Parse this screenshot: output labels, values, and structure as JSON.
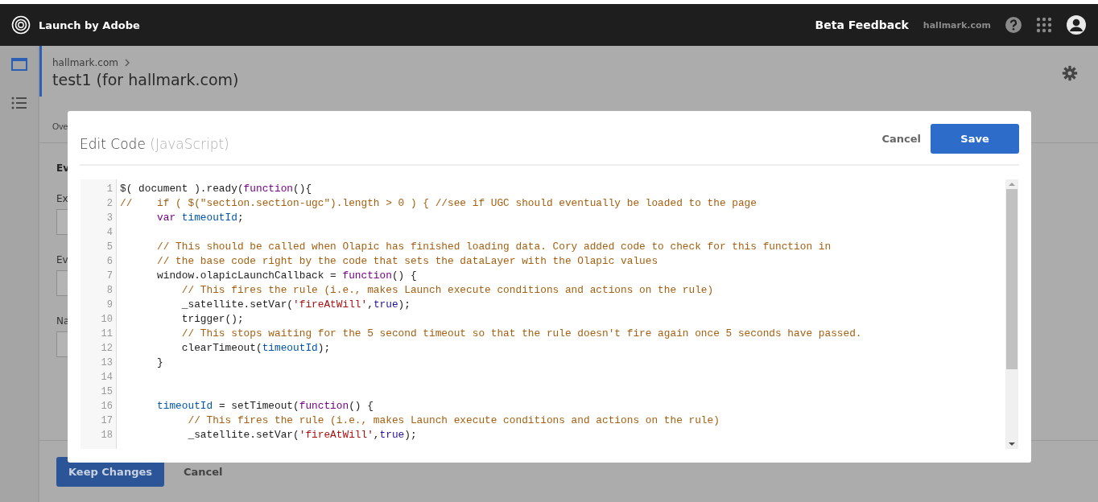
{
  "top_bar": {
    "product": "Launch by Adobe",
    "feedback": "Beta Feedback",
    "org": "hallmark.com"
  },
  "sidebar": {
    "items": [
      {
        "kind": "window",
        "selected": true
      },
      {
        "kind": "list",
        "selected": false
      }
    ]
  },
  "page": {
    "breadcrumb": "hallmark.com",
    "title": "test1 (for hallmark.com)",
    "tab": "Ove",
    "section": "Ev",
    "fields": [
      {
        "label": "Ex"
      },
      {
        "label": "Ev"
      },
      {
        "label": "Na"
      }
    ],
    "primary_button": "Keep Changes",
    "secondary_button": "Cancel"
  },
  "modal": {
    "title": "Edit Code",
    "subtitle": "(JavaScript)",
    "cancel": "Cancel",
    "save": "Save",
    "lines": [
      {
        "n": "1",
        "tokens": [
          {
            "kind": "plain",
            "t": "$( document ).ready("
          },
          {
            "kind": "keyword",
            "t": "function"
          },
          {
            "kind": "plain",
            "t": "(){"
          }
        ]
      },
      {
        "n": "2",
        "tokens": [
          {
            "kind": "comment",
            "t": "//    if ( $(\"section.section-ugc\").length > 0 ) { //see if UGC should eventually be loaded to the page"
          }
        ]
      },
      {
        "n": "3",
        "tokens": [
          {
            "kind": "keyword",
            "t": "      var "
          },
          {
            "kind": "variable",
            "t": "timeoutId"
          },
          {
            "kind": "plain",
            "t": ";"
          }
        ]
      },
      {
        "n": "4"
      },
      {
        "n": "5",
        "tokens": [
          {
            "kind": "comment",
            "t": "      // This should be called when Olapic has finished loading data. Cory added code to check for this function in"
          }
        ]
      },
      {
        "n": "6",
        "tokens": [
          {
            "kind": "comment",
            "t": "      // the base code right by the code that sets the dataLayer with the Olapic values"
          }
        ]
      },
      {
        "n": "7",
        "tokens": [
          {
            "kind": "plain",
            "t": "      window.olapicLaunchCallback = "
          },
          {
            "kind": "keyword",
            "t": "function"
          },
          {
            "kind": "plain",
            "t": "() {"
          }
        ]
      },
      {
        "n": "8",
        "tokens": [
          {
            "kind": "comment",
            "t": "          // This fires the rule (i.e., makes Launch execute conditions and actions on the rule)"
          }
        ]
      },
      {
        "n": "9",
        "tokens": [
          {
            "kind": "plain",
            "t": "          _satellite.setVar("
          },
          {
            "kind": "string",
            "t": "'fireAtWill'"
          },
          {
            "kind": "plain",
            "t": ","
          },
          {
            "kind": "atom",
            "t": "true"
          },
          {
            "kind": "plain",
            "t": ");"
          }
        ]
      },
      {
        "n": "10",
        "tokens": [
          {
            "kind": "plain",
            "t": "          trigger();"
          }
        ]
      },
      {
        "n": "11",
        "tokens": [
          {
            "kind": "comment",
            "t": "          // This stops waiting for the 5 second timeout so that the rule doesn't fire again once 5 seconds have passed."
          }
        ]
      },
      {
        "n": "12",
        "tokens": [
          {
            "kind": "plain",
            "t": "          clearTimeout("
          },
          {
            "kind": "variable",
            "t": "timeoutId"
          },
          {
            "kind": "plain",
            "t": ");"
          }
        ]
      },
      {
        "n": "13",
        "tokens": [
          {
            "kind": "plain",
            "t": "      }"
          }
        ]
      },
      {
        "n": "14"
      },
      {
        "n": "15"
      },
      {
        "n": "16",
        "tokens": [
          {
            "kind": "variable",
            "t": "      timeoutId"
          },
          {
            "kind": "plain",
            "t": " = setTimeout("
          },
          {
            "kind": "keyword",
            "t": "function"
          },
          {
            "kind": "plain",
            "t": "() {"
          }
        ]
      },
      {
        "n": "17",
        "tokens": [
          {
            "kind": "comment",
            "t": "           // This fires the rule (i.e., makes Launch execute conditions and actions on the rule)"
          }
        ]
      },
      {
        "n": "18",
        "tokens": [
          {
            "kind": "plain",
            "t": "           _satellite.setVar("
          },
          {
            "kind": "string",
            "t": "'fireAtWill'"
          },
          {
            "kind": "plain",
            "t": ","
          },
          {
            "kind": "atom",
            "t": "true"
          },
          {
            "kind": "plain",
            "t": ");"
          }
        ]
      }
    ]
  }
}
